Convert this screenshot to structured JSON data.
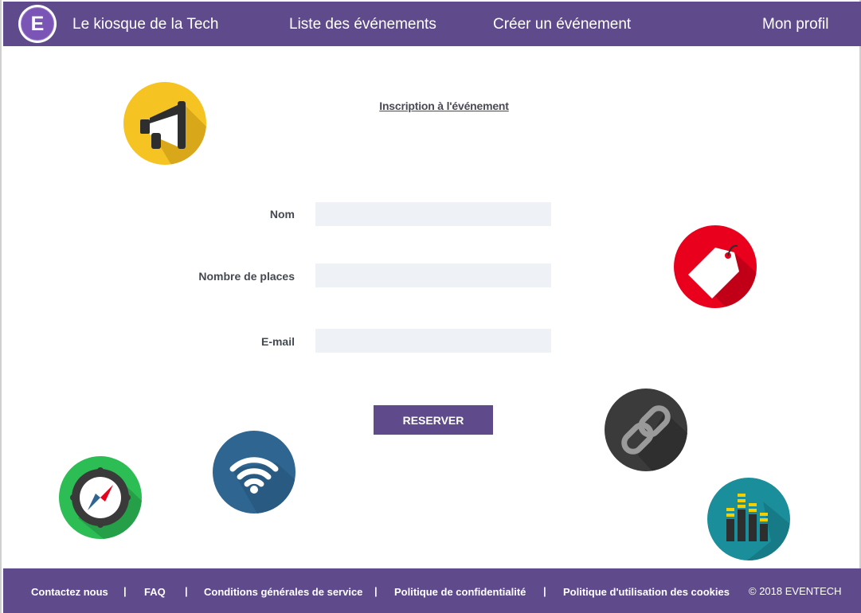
{
  "header": {
    "logo_letter": "E",
    "brand": "Le kiosque de la Tech",
    "nav": {
      "list_events": "Liste des événements",
      "create_event": "Créer un événement",
      "profile": "Mon profil"
    }
  },
  "form": {
    "title": "Inscription à l'événement",
    "fields": {
      "name_label": "Nom",
      "name_value": "",
      "places_label": "Nombre de places",
      "places_value": "",
      "email_label": "E-mail",
      "email_value": ""
    },
    "submit_label": "RESERVER"
  },
  "decorative_icons": [
    "megaphone-icon",
    "price-tag-icon",
    "link-icon",
    "wifi-icon",
    "compass-icon",
    "equalizer-icon"
  ],
  "colors": {
    "primary": "#5f4b8b",
    "input_bg": "#eef1f5",
    "megaphone": "#f5c322",
    "tag": "#e8001c",
    "link": "#3b3b3b",
    "wifi": "#2f6591",
    "compass": "#2dbd55",
    "equalizer": "#1a8f9b"
  },
  "footer": {
    "contact": "Contactez nous",
    "faq": "FAQ",
    "terms": "Conditions générales de service",
    "privacy": "Politique de confidentialité",
    "cookies": "Politique d'utilisation des cookies",
    "separator": "|",
    "copyright": "© 2018 EVENTECH"
  }
}
